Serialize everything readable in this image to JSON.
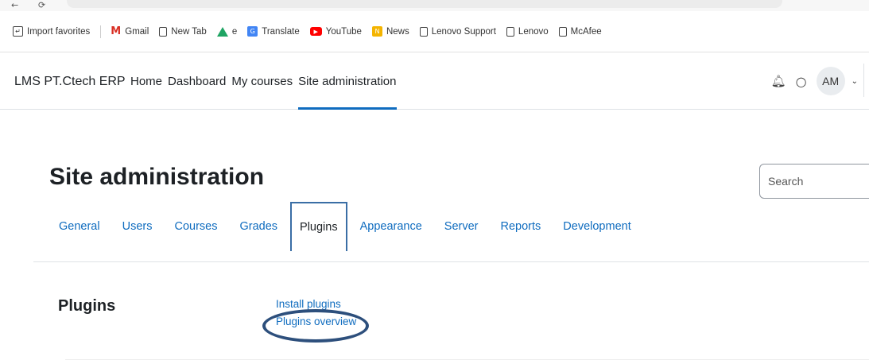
{
  "bookmarks": [
    {
      "icon": "import-icon",
      "label": "Import favorites"
    },
    {
      "icon": "gmail-icon",
      "label": "Gmail"
    },
    {
      "icon": "file-icon",
      "label": "New Tab"
    },
    {
      "icon": "google-drive-icon",
      "label": "e"
    },
    {
      "icon": "translate-icon",
      "label": "Translate"
    },
    {
      "icon": "youtube-icon",
      "label": "YouTube"
    },
    {
      "icon": "news-icon",
      "label": "News"
    },
    {
      "icon": "file-icon",
      "label": "Lenovo Support"
    },
    {
      "icon": "file-icon",
      "label": "Lenovo"
    },
    {
      "icon": "file-icon",
      "label": "McAfee"
    }
  ],
  "navbar": {
    "brand": "LMS PT.Ctech ERP",
    "links": [
      "Home",
      "Dashboard",
      "My courses",
      "Site administration"
    ],
    "active_link": "Site administration",
    "avatar_initials": "AM"
  },
  "page": {
    "title": "Site administration",
    "search_placeholder": "Search"
  },
  "admin_tabs": {
    "items": [
      "General",
      "Users",
      "Courses",
      "Grades",
      "Plugins",
      "Appearance",
      "Server",
      "Reports",
      "Development"
    ],
    "active": "Plugins"
  },
  "plugins_section": {
    "title": "Plugins",
    "links": [
      "Install plugins",
      "Plugins overview"
    ]
  },
  "colors": {
    "link": "#0f6cbf",
    "active_underline": "#0f6cbf",
    "annotation": "#2d4f7c"
  }
}
